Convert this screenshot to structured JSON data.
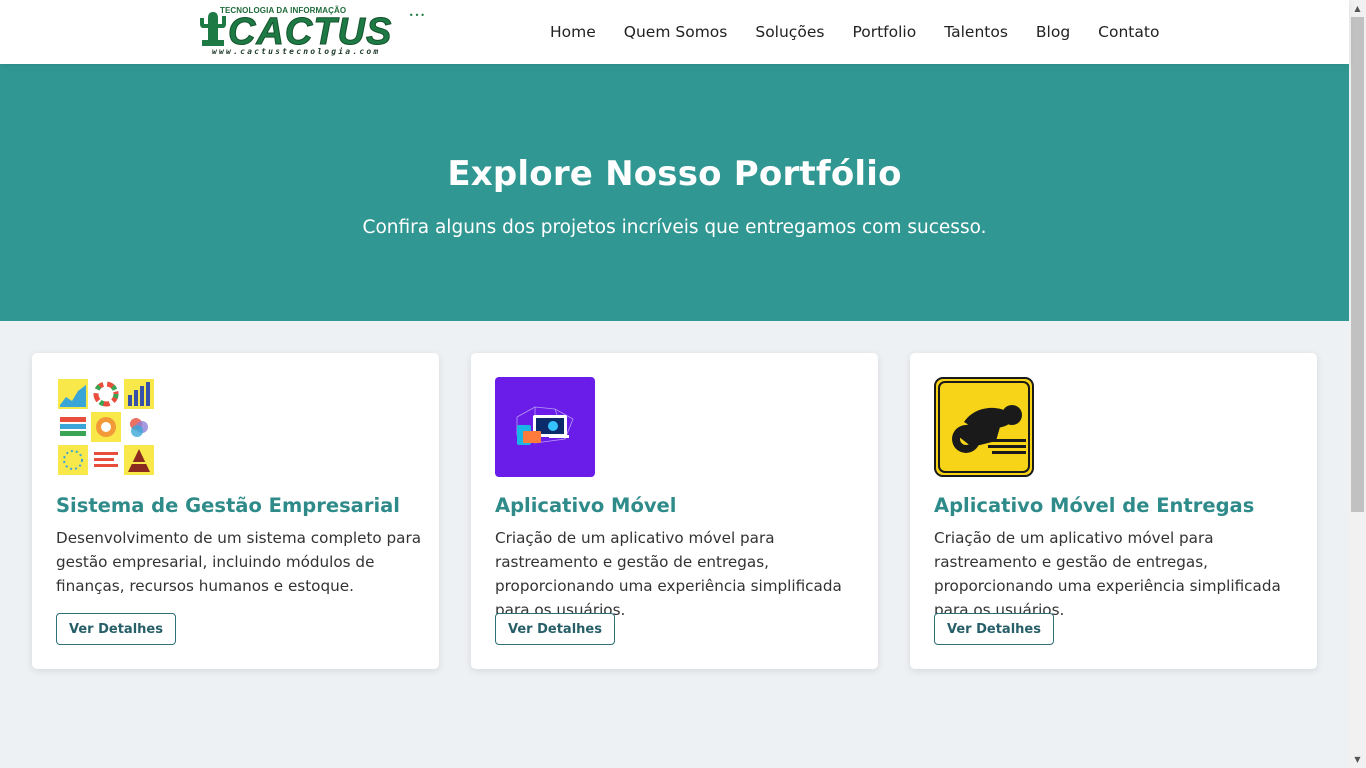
{
  "brand": {
    "tagline": "TECNOLOGIA DA INFORMAÇÃO",
    "name": "CACTUS",
    "url": "www.cactustecnologia.com"
  },
  "nav": {
    "items": [
      {
        "label": "Home"
      },
      {
        "label": "Quem Somos"
      },
      {
        "label": "Soluções"
      },
      {
        "label": "Portfolio"
      },
      {
        "label": "Talentos"
      },
      {
        "label": "Blog"
      },
      {
        "label": "Contato"
      }
    ]
  },
  "hero": {
    "title": "Explore Nosso Portfólio",
    "subtitle": "Confira alguns dos projetos incríveis que entregamos com sucesso."
  },
  "projects": [
    {
      "title": "Sistema de Gestão Empresarial",
      "description": "Desenvolvimento de um sistema completo para gestão empresarial, incluindo módulos de finanças, recursos humanos e estoque.",
      "button": "Ver Detalhes",
      "icon": "dashboard-charts-icon"
    },
    {
      "title": "Aplicativo Móvel",
      "description": "Criação de um aplicativo móvel para rastreamento e gestão de entregas, proporcionando uma experiência simplificada para os usuários.",
      "button": "Ver Detalhes",
      "icon": "devices-network-icon"
    },
    {
      "title": "Aplicativo Móvel de Entregas",
      "description": "Criação de um aplicativo móvel para rastreamento e gestão de entregas, proporcionando uma experiência simplificada para os usuários.",
      "button": "Ver Detalhes",
      "icon": "motorcycle-sign-icon"
    }
  ],
  "colors": {
    "hero_bg": "#319792",
    "card_title": "#2e8b8a",
    "page_bg": "#eef1f4"
  }
}
